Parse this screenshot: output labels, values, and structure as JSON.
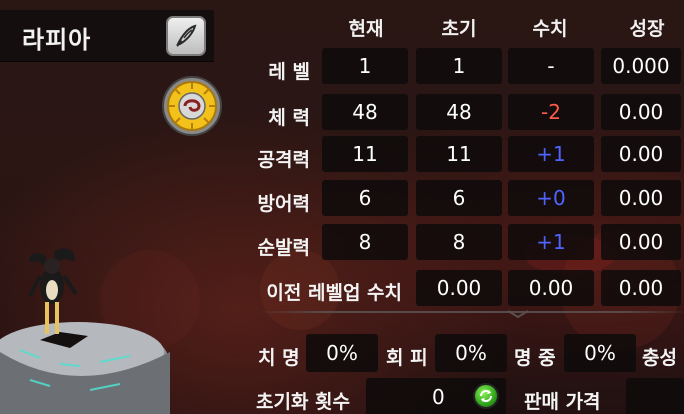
{
  "character": {
    "name": "라피아"
  },
  "headers": {
    "current": "현재",
    "initial": "초기",
    "value": "수치",
    "growth": "성장"
  },
  "rows": [
    {
      "label": "레 벨",
      "current": "1",
      "initial": "1",
      "value": "-",
      "growth": "0.000",
      "value_color": "#ffffff"
    },
    {
      "label": "체 력",
      "current": "48",
      "initial": "48",
      "value": "-2",
      "growth": "0.00",
      "value_color": "#ff5b4a"
    },
    {
      "label": "공격력",
      "current": "11",
      "initial": "11",
      "value": "+1",
      "growth": "0.00",
      "value_color": "#4f64ff"
    },
    {
      "label": "방어력",
      "current": "6",
      "initial": "6",
      "value": "+0",
      "growth": "0.00",
      "value_color": "#4f64ff"
    },
    {
      "label": "순발력",
      "current": "8",
      "initial": "8",
      "value": "+1",
      "growth": "0.00",
      "value_color": "#4f64ff"
    }
  ],
  "prev_levelup": {
    "label": "이전 레벨업 수치",
    "v1": "0.00",
    "v2": "0.00",
    "v3": "0.00"
  },
  "secondary": {
    "crit": {
      "label": "치 명",
      "value": "0%"
    },
    "evade": {
      "label": "회 피",
      "value": "0%"
    },
    "accuracy": {
      "label": "명 중",
      "value": "0%"
    },
    "extra_label": "충성"
  },
  "reset": {
    "label": "초기화 횟수",
    "value": "0"
  },
  "sell": {
    "label": "판매 가격"
  },
  "icons": {
    "edit": "quill-edit-icon",
    "element": "fire-wheel-icon",
    "reset": "refresh-icon"
  }
}
